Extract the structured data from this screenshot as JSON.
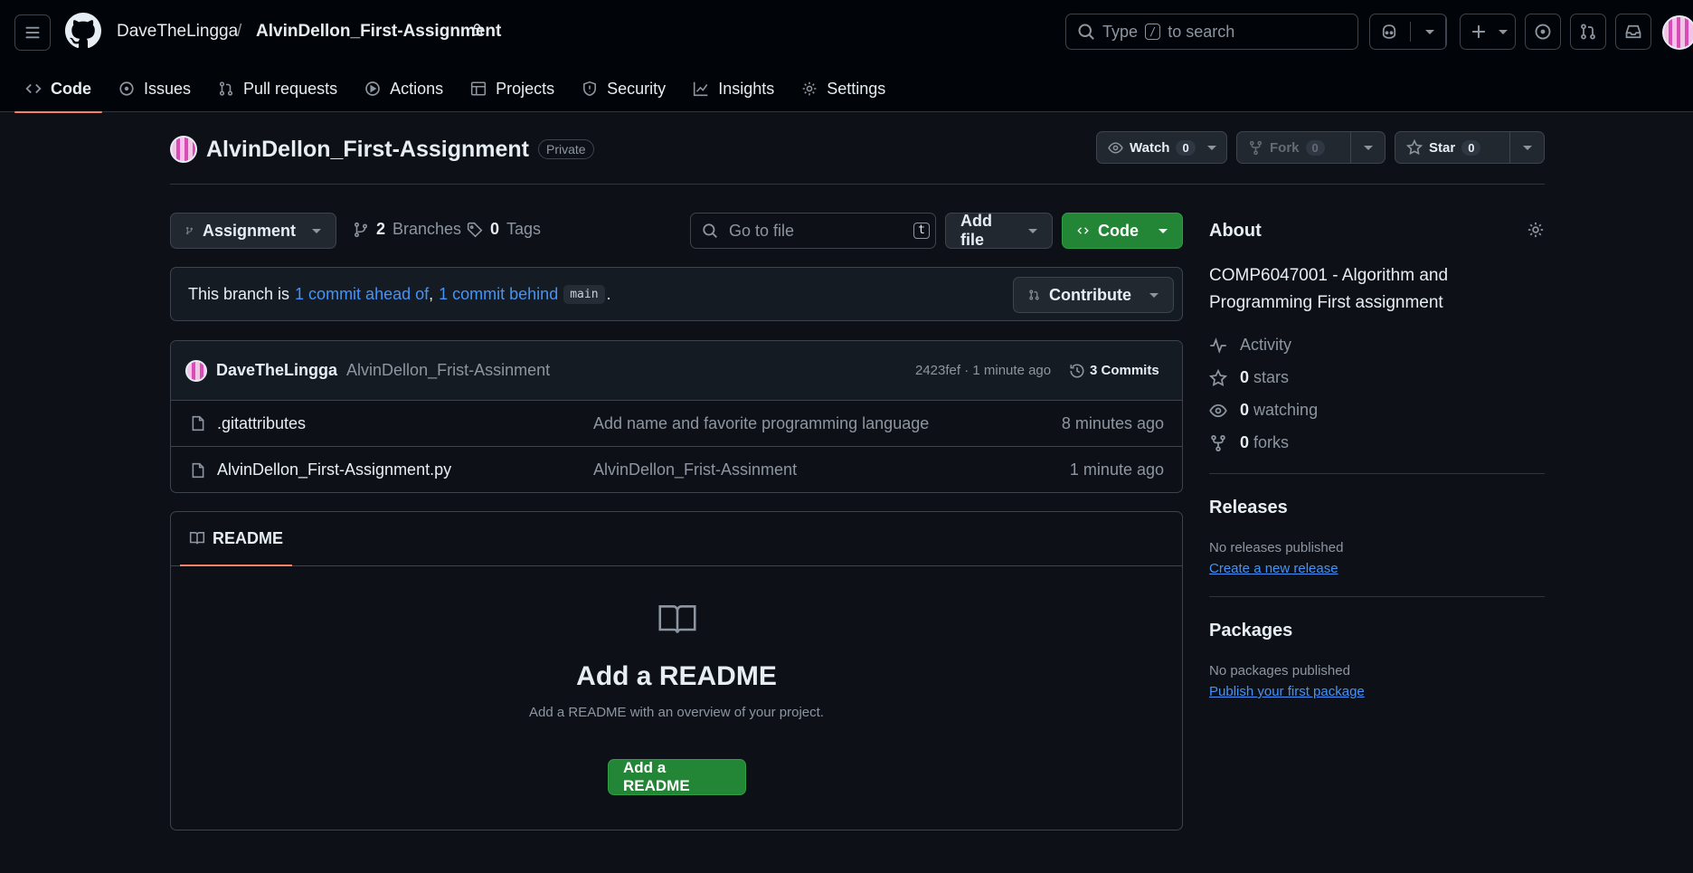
{
  "header": {
    "owner": "DaveTheLingga",
    "slash": "/",
    "repo": "AlvinDellon_First-Assignment",
    "search_pre": "Type",
    "search_key": "/",
    "search_post": "to search"
  },
  "tabs": [
    {
      "label": "Code",
      "icon": "code-icon"
    },
    {
      "label": "Issues",
      "icon": "issue-icon"
    },
    {
      "label": "Pull requests",
      "icon": "pull-request-icon"
    },
    {
      "label": "Actions",
      "icon": "play-icon"
    },
    {
      "label": "Projects",
      "icon": "table-icon"
    },
    {
      "label": "Security",
      "icon": "shield-icon"
    },
    {
      "label": "Insights",
      "icon": "graph-icon"
    },
    {
      "label": "Settings",
      "icon": "gear-icon"
    }
  ],
  "repo": {
    "name": "AlvinDellon_First-Assignment",
    "visibility": "Private",
    "watch_label": "Watch",
    "watch_count": "0",
    "fork_label": "Fork",
    "fork_count": "0",
    "star_label": "Star",
    "star_count": "0"
  },
  "nav": {
    "branch": "Assignment",
    "branches_count": "2",
    "branches_label": "Branches",
    "tags_count": "0",
    "tags_label": "Tags",
    "goto_placeholder": "Go to file",
    "goto_key": "t",
    "add_file": "Add file",
    "code": "Code"
  },
  "branch_status": {
    "prefix": "This branch is",
    "ahead": "1 commit ahead of",
    "comma": ",",
    "behind": "1 commit behind",
    "base": "main",
    "suffix": ".",
    "contribute": "Contribute"
  },
  "commit": {
    "author": "DaveTheLingga",
    "message": "AlvinDellon_Frist-Assinment",
    "meta": "2423fef · 1 minute ago",
    "commits": "3 Commits"
  },
  "files": [
    {
      "name": ".gitattributes",
      "message": "Add name and favorite programming language",
      "time": "8 minutes ago"
    },
    {
      "name": "AlvinDellon_First-Assignment.py",
      "message": "AlvinDellon_Frist-Assinment",
      "time": "1 minute ago"
    }
  ],
  "readme": {
    "tab": "README",
    "heading": "Add a README",
    "desc": "Add a README with an overview of your project.",
    "button": "Add a README"
  },
  "about": {
    "title": "About",
    "description": "COMP6047001 - Algorithm and Programming First assignment",
    "activity": "Activity",
    "stars_count": "0",
    "stars_label": "stars",
    "watching_count": "0",
    "watching_label": "watching",
    "forks_count": "0",
    "forks_label": "forks"
  },
  "releases": {
    "title": "Releases",
    "empty": "No releases published",
    "link": "Create a new release"
  },
  "packages": {
    "title": "Packages",
    "empty": "No packages published",
    "link": "Publish your first package"
  },
  "colors": {
    "bg": "#0d1117",
    "header_bg": "#010409",
    "accent_green": "#238636",
    "link": "#4493f8",
    "tab_underline": "#f78166"
  }
}
